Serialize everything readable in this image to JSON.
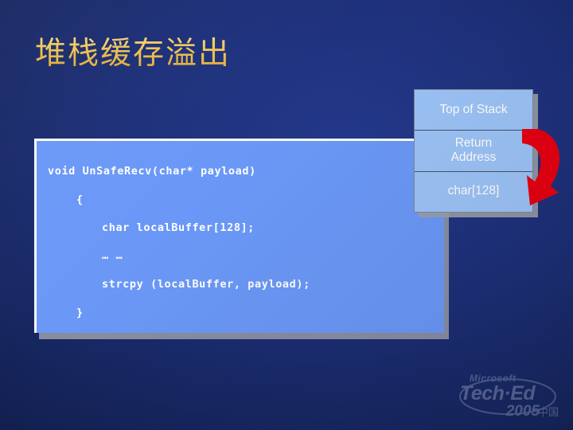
{
  "slide": {
    "title": "堆栈缓存溢出",
    "title_color": "#f0c556",
    "background_color": "#1d2f78"
  },
  "code_panel": {
    "background_color": "#6b98f7",
    "text_color": "#ffffff",
    "lines": [
      "void UnSafeRecv(char* payload)",
      "{",
      "char localBuffer[128];",
      "… …",
      "strcpy (localBuffer, payload);",
      "}"
    ]
  },
  "stack_diagram": {
    "cell_color": "#9cc3f7",
    "text_color": "#ffffff",
    "cells": [
      {
        "label": "Top of Stack"
      },
      {
        "label": "Return\nAddress"
      },
      {
        "label": "char[128]"
      }
    ],
    "arrow": {
      "name": "overflow-arrow",
      "color": "#e60012",
      "direction": "curved-down-left"
    }
  },
  "logo": {
    "brand": "Microsoft",
    "event": "Tech·Ed",
    "year": "2005",
    "region": "中国"
  }
}
